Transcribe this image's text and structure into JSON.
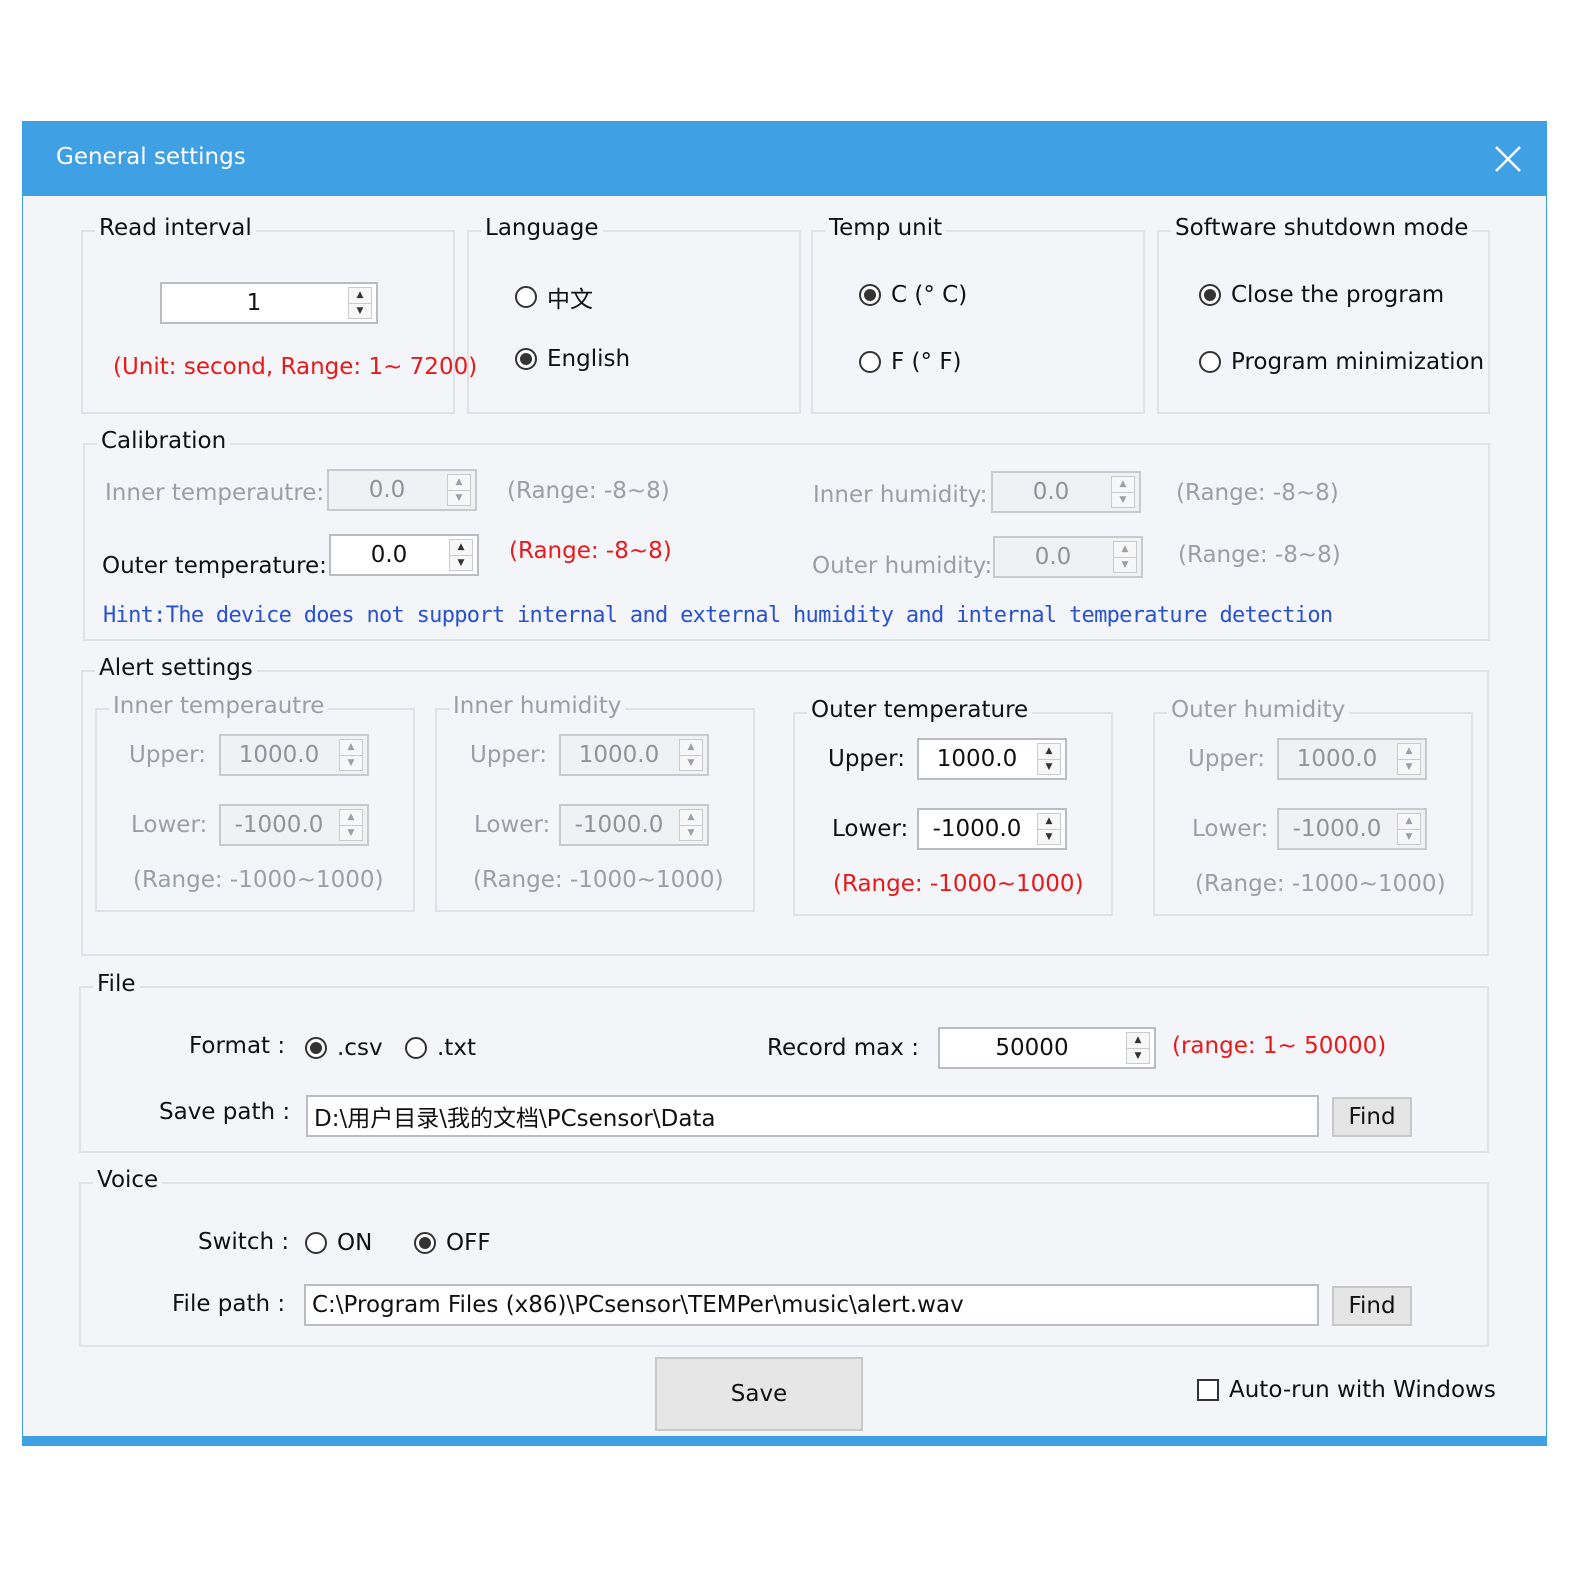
{
  "window": {
    "title": "General settings"
  },
  "read_interval": {
    "legend": "Read interval",
    "value": "1",
    "hint": "(Unit: second, Range: 1~ 7200)"
  },
  "language": {
    "legend": "Language",
    "options": [
      "中文",
      "English"
    ],
    "selected": "English"
  },
  "temp_unit": {
    "legend": "Temp unit",
    "options": [
      "C (° C)",
      "F (° F)"
    ],
    "selected": "C (° C)"
  },
  "shutdown": {
    "legend": "Software shutdown mode",
    "options": [
      "Close the program",
      "Program minimization"
    ],
    "selected": "Close the program"
  },
  "calibration": {
    "legend": "Calibration",
    "inner_temp": {
      "label": "Inner temperautre:",
      "value": "0.0",
      "range": "(Range:  -8~8)"
    },
    "outer_temp": {
      "label": "Outer temperature:",
      "value": "0.0",
      "range": "(Range:  -8~8)"
    },
    "inner_humidity": {
      "label": "Inner humidity:",
      "value": "0.0",
      "range": "(Range:  -8~8)"
    },
    "outer_humidity": {
      "label": "Outer humidity:",
      "value": "0.0",
      "range": "(Range:  -8~8)"
    },
    "hint": "Hint:The device does not support internal and external humidity and internal temperature detection"
  },
  "alert": {
    "legend": "Alert settings",
    "groups": [
      {
        "title": "Inner temperautre",
        "upper_label": "Upper:",
        "upper": "1000.0",
        "lower_label": "Lower:",
        "lower": "-1000.0",
        "range": "(Range:  -1000~1000)"
      },
      {
        "title": "Inner humidity",
        "upper_label": "Upper:",
        "upper": "1000.0",
        "lower_label": "Lower:",
        "lower": "-1000.0",
        "range": "(Range:  -1000~1000)"
      },
      {
        "title": "Outer temperature",
        "upper_label": "Upper:",
        "upper": "1000.0",
        "lower_label": "Lower:",
        "lower": "-1000.0",
        "range": "(Range:  -1000~1000)"
      },
      {
        "title": "Outer humidity",
        "upper_label": "Upper:",
        "upper": "1000.0",
        "lower_label": "Lower:",
        "lower": "-1000.0",
        "range": "(Range:  -1000~1000)"
      }
    ]
  },
  "file": {
    "legend": "File",
    "format_label": "Format :",
    "format_options": [
      ".csv",
      ".txt"
    ],
    "format_selected": ".csv",
    "record_max_label": "Record max :",
    "record_max": "50000",
    "record_range": "(range: 1~ 50000)",
    "save_path_label": "Save path :",
    "save_path": "D:\\用户目录\\我的文档\\PCsensor\\Data",
    "find_label": "Find"
  },
  "voice": {
    "legend": "Voice",
    "switch_label": "Switch :",
    "switch_options": [
      "ON",
      "OFF"
    ],
    "switch_selected": "OFF",
    "file_path_label": "File path :",
    "file_path": "C:\\Program Files (x86)\\PCsensor\\TEMPer\\music\\alert.wav",
    "find_label": "Find"
  },
  "footer": {
    "save_label": "Save",
    "autorun_label": "Auto-run with Windows",
    "autorun_checked": false
  },
  "colors": {
    "titlebar": "#3fa0e4",
    "accent_red": "#e8191b",
    "hint_blue": "#2a52d0",
    "disabled_gray": "#9aa0a6"
  }
}
